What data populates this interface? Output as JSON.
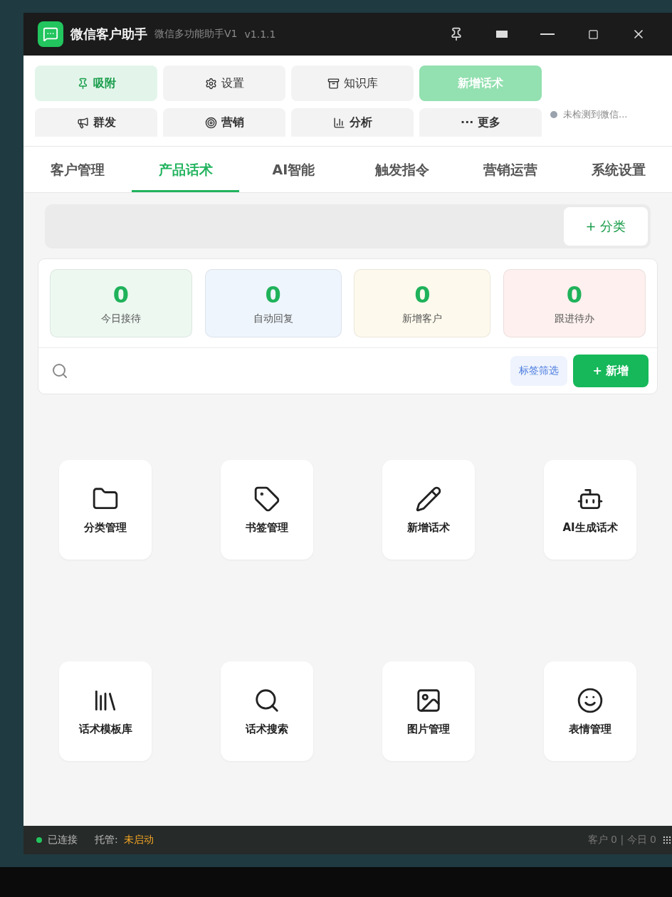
{
  "window": {
    "title": "微信客户助手",
    "subtitle": "微信多功能助手V1",
    "version": "v1.1.1"
  },
  "toolbar": [
    {
      "label": "吸附",
      "kind": "active"
    },
    {
      "label": "设置",
      "kind": "normal"
    },
    {
      "label": "知识库",
      "kind": "normal"
    },
    {
      "label": "新增话术",
      "kind": "primary"
    },
    {
      "label": "群发",
      "kind": "normal"
    },
    {
      "label": "营销",
      "kind": "normal"
    },
    {
      "label": "分析",
      "kind": "normal"
    },
    {
      "label": "··· 更多",
      "kind": "normal"
    }
  ],
  "wechat_status": {
    "text": "未检测到微信...",
    "color": "#9aa3ad"
  },
  "tabs": [
    {
      "label": "客户管理",
      "selected": false
    },
    {
      "label": "产品话术",
      "selected": true
    },
    {
      "label": "AI智能",
      "selected": false
    },
    {
      "label": "触发指令",
      "selected": false
    },
    {
      "label": "营销运营",
      "selected": false
    },
    {
      "label": "系统设置",
      "selected": false
    }
  ],
  "category_button": "+ 分类",
  "stats": [
    {
      "value": "0",
      "label": "今日接待",
      "color": "#edf8f1"
    },
    {
      "value": "0",
      "label": "自动回复",
      "color": "#eef5fd"
    },
    {
      "value": "0",
      "label": "新增客户",
      "color": "#fdf9ec"
    },
    {
      "value": "0",
      "label": "跟进待办",
      "color": "#fdf0ee"
    }
  ],
  "tag_filter": "标签筛选",
  "add_button": "+ 新增",
  "tiles": [
    {
      "label": "分类管理"
    },
    {
      "label": "书签管理"
    },
    {
      "label": "新增话术"
    },
    {
      "label": "AI生成话术"
    },
    {
      "label": "话术模板库"
    },
    {
      "label": "话术搜索"
    },
    {
      "label": "图片管理"
    },
    {
      "label": "表情管理"
    }
  ],
  "status_bar": {
    "connection": {
      "text": "已连接",
      "color": "#22c55e"
    },
    "hosting_label": "托管:",
    "hosting_value": "未启动",
    "counts": "客户 0 | 今日 0"
  }
}
